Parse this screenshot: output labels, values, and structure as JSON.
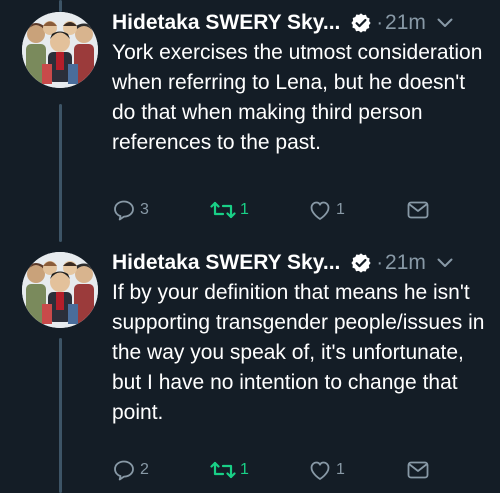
{
  "tweets": [
    {
      "author": "Hidetaka SWERY Sky...",
      "time": "21m",
      "text": "York exercises the utmost consideration when referring to Lena, but he doesn't do that when making third person references to the past.",
      "replies": "3",
      "retweets": "1",
      "likes": "1"
    },
    {
      "author": "Hidetaka SWERY Sky...",
      "time": "21m",
      "text": "If by your definition that means he isn't supporting transgender people/issues in the way you speak of, it's unfortunate, but I have no intention to change that point.",
      "replies": "2",
      "retweets": "1",
      "likes": "1"
    }
  ],
  "separator": "·",
  "icons": {
    "verified": "verified-badge-icon",
    "chevron": "chevron-down-icon",
    "reply": "reply-icon",
    "retweet": "retweet-icon",
    "like": "heart-icon",
    "message": "direct-message-icon"
  },
  "colors": {
    "background": "#141d26",
    "text": "#ffffff",
    "muted": "#8899a6",
    "retweet_active": "#19cf86",
    "thread_line": "#3d5466"
  }
}
